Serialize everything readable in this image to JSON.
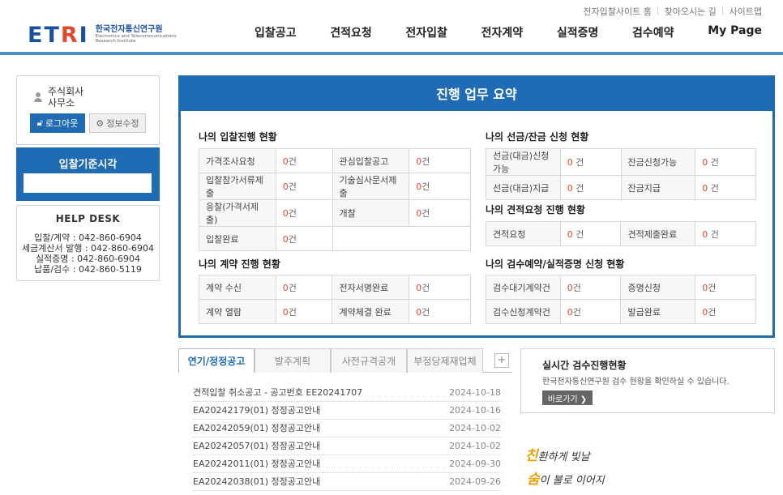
{
  "util_links": [
    "전자입찰사이트 홈",
    "찾아오시는 길",
    "사이트맵"
  ],
  "logo": {
    "mark_left": "ET",
    "mark_r": "R",
    "mark_right": "I",
    "kr": "한국전자통신연구원",
    "en_1": "Electronics and Telecommunications",
    "en_2": "Research Institute"
  },
  "nav": [
    "입찰공고",
    "견적요청",
    "전자입찰",
    "전자계약",
    "실적증명",
    "검수예약",
    "My Page"
  ],
  "user": {
    "line1": "주식회사",
    "line2": "사무소",
    "logout_label": "로그아웃",
    "info_label": "정보수정"
  },
  "bid_time": {
    "title": "입찰기준시각",
    "value": ""
  },
  "help": {
    "title": "HELP DESK",
    "lines": [
      "입찰/계약 : 042-860-6904",
      "세금계산서 발행 : 042-860-6904",
      "실적증명 : 042-860-6904",
      "납품/검수 : 042-860-5119"
    ]
  },
  "summary": {
    "title": "진행 업무 요약",
    "count_unit": "건",
    "sections": {
      "bid": {
        "title": "나의 입찰진행 현황",
        "rows": [
          [
            "가격조사요청",
            "0",
            "관심입찰공고",
            "0"
          ],
          [
            "입찰참가서류제출",
            "0",
            "기술심사문서제출",
            "0"
          ],
          [
            "응찰(가격서제출)",
            "0",
            "개찰",
            "0"
          ],
          [
            "입찰완료",
            "0",
            "",
            ""
          ]
        ]
      },
      "contract": {
        "title": "나의 계약 진행 현황",
        "rows": [
          [
            "계약 수신",
            "0",
            "전자서명완료",
            "0"
          ],
          [
            "계약 열람",
            "0",
            "계약체결 완료",
            "0"
          ]
        ]
      },
      "advance": {
        "title": "나의 선금/잔금 신청 현황",
        "rows": [
          [
            "선금(대금)신청가능",
            "0",
            "잔금신청가능",
            "0"
          ],
          [
            "선금(대금)지급",
            "0",
            "잔금지급",
            "0"
          ]
        ]
      },
      "quote": {
        "title": "나의 견적요청 진행 현황",
        "rows": [
          [
            "견적요청",
            "0",
            "견적제출완료",
            "0"
          ]
        ]
      },
      "inspect": {
        "title": "나의 검수예약/실적증명 신청 현황",
        "rows": [
          [
            "검수대기계약건",
            "0",
            "증명신청",
            "0"
          ],
          [
            "검수신청계약건",
            "0",
            "발급완료",
            "0"
          ]
        ]
      }
    }
  },
  "tabs": {
    "items": [
      "연기/정정공고",
      "발주계획",
      "사전규격공개",
      "부정당제재업체"
    ],
    "active": 0,
    "plus": "+"
  },
  "notices": [
    {
      "title": "견적입찰 취소공고 - 공고번호 EE20241707",
      "date": "2024-10-18"
    },
    {
      "title": "EA20242179(01) 정정공고안내",
      "date": "2024-10-16"
    },
    {
      "title": "EA20242059(01) 정정공고안내",
      "date": "2024-10-02"
    },
    {
      "title": "EA20242057(01) 정정공고안내",
      "date": "2024-10-02"
    },
    {
      "title": "EA20242011(01) 정정공고안내",
      "date": "2024-09-30"
    },
    {
      "title": "EA20242038(01) 정정공고안내",
      "date": "2024-09-26"
    }
  ],
  "inspect_box": {
    "title": "실시간 검수진행현황",
    "desc": "한국전자통신연구원 검수 현황을 확인하실 수 있습니다.",
    "button": "바로가기 ❯"
  },
  "slogan": {
    "l1_hl": "친",
    "l1_rest": "환하게 빛날",
    "l2_hl": "숨",
    "l2_rest": "이 불로 이어지",
    "note": ""
  },
  "colors": {
    "brand_blue": "#1f6bb4",
    "accent_red": "#e04a2f",
    "header_line": "#4a90c8"
  }
}
